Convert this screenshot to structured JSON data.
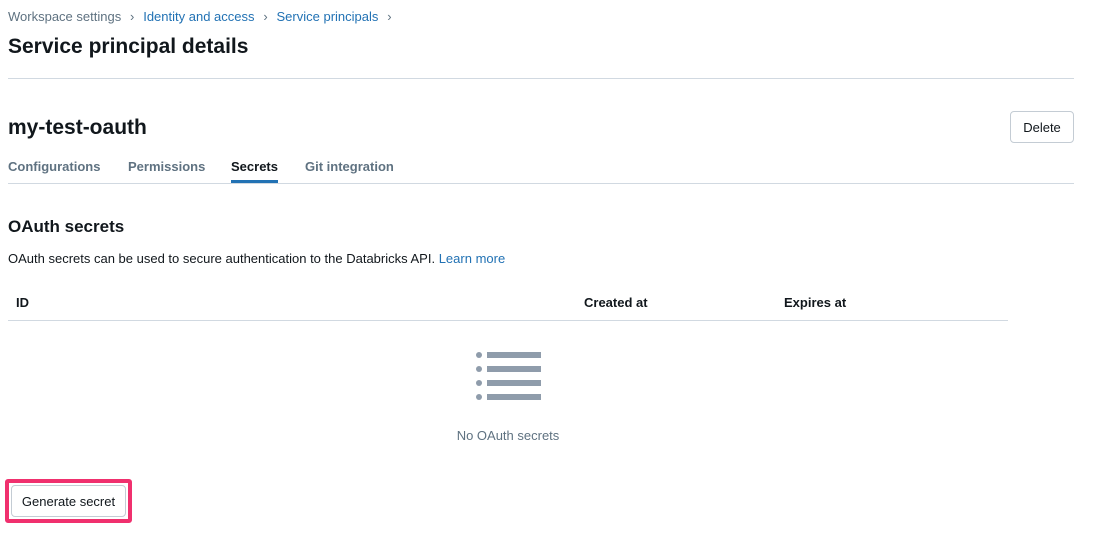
{
  "breadcrumb": {
    "items": [
      {
        "label": "Workspace settings"
      },
      {
        "label": "Identity and access"
      },
      {
        "label": "Service principals"
      }
    ],
    "separator": "›"
  },
  "page_title": "Service principal details",
  "entity": {
    "name": "my-test-oauth",
    "delete_label": "Delete"
  },
  "tabs": [
    {
      "label": "Configurations",
      "active": false
    },
    {
      "label": "Permissions",
      "active": false
    },
    {
      "label": "Secrets",
      "active": true
    },
    {
      "label": "Git integration",
      "active": false
    }
  ],
  "section": {
    "title": "OAuth secrets",
    "description": "OAuth secrets can be used to secure authentication to the Databricks API.",
    "learn_more": "Learn more"
  },
  "table": {
    "columns": [
      "ID",
      "Created at",
      "Expires at"
    ],
    "rows": [],
    "empty_text": "No OAuth secrets",
    "empty_icon": "list-icon"
  },
  "actions": {
    "generate_label": "Generate secret"
  },
  "colors": {
    "link": "#2272b4",
    "highlight": "#f0306e",
    "muted": "#5f7281",
    "icon": "#8f9cab"
  }
}
